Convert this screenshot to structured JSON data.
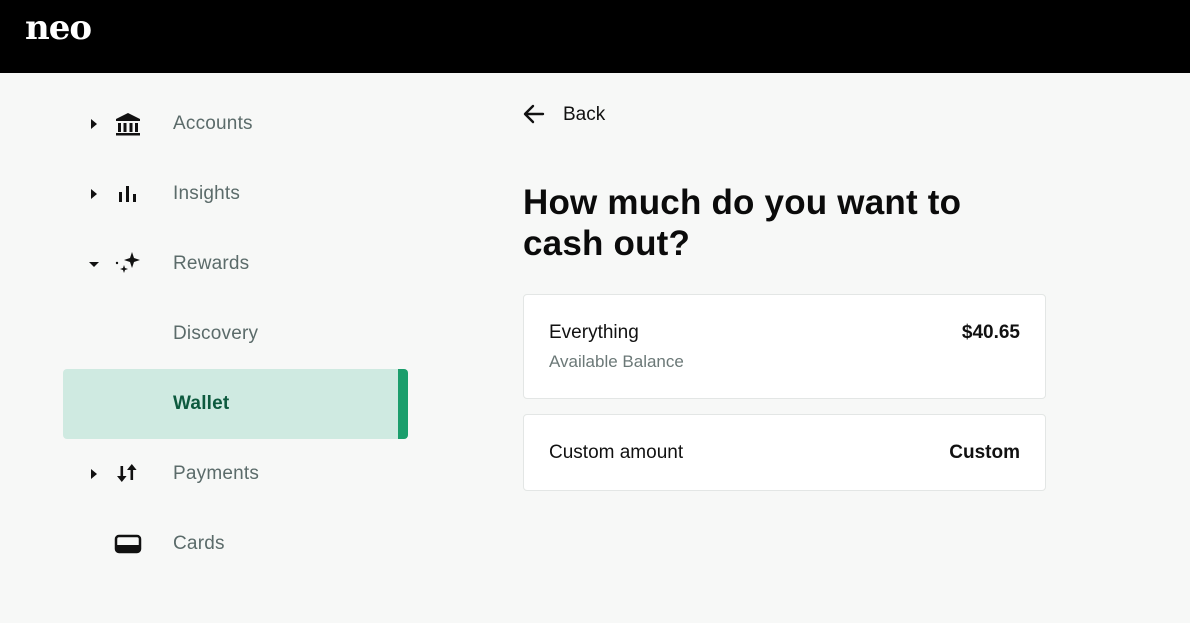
{
  "brand": {
    "logo_text": "neo"
  },
  "sidebar": {
    "items": [
      {
        "label": "Accounts",
        "icon": "bank-icon",
        "caret": "right",
        "active": false
      },
      {
        "label": "Insights",
        "icon": "bar-chart-icon",
        "caret": "right",
        "active": false
      },
      {
        "label": "Rewards",
        "icon": "sparkle-icon",
        "caret": "down",
        "active": false
      },
      {
        "label": "Discovery",
        "icon": "",
        "caret": "",
        "active": false
      },
      {
        "label": "Wallet",
        "icon": "",
        "caret": "",
        "active": true
      },
      {
        "label": "Payments",
        "icon": "transfer-arrows-icon",
        "caret": "right",
        "active": false
      },
      {
        "label": "Cards",
        "icon": "card-icon",
        "caret": "",
        "active": false
      }
    ]
  },
  "main": {
    "back_label": "Back",
    "title": "How much do you want to cash out?",
    "options": [
      {
        "title": "Everything",
        "subtitle": "Available Balance",
        "value": "$40.65"
      },
      {
        "title": "Custom amount",
        "value": "Custom"
      }
    ]
  },
  "colors": {
    "topbar": "#000000",
    "background": "#f7f8f7",
    "active_bg": "#cfeae1",
    "active_accent": "#1b9e6c",
    "active_text": "#0d5a3e",
    "nav_text": "#5b6b6a"
  }
}
